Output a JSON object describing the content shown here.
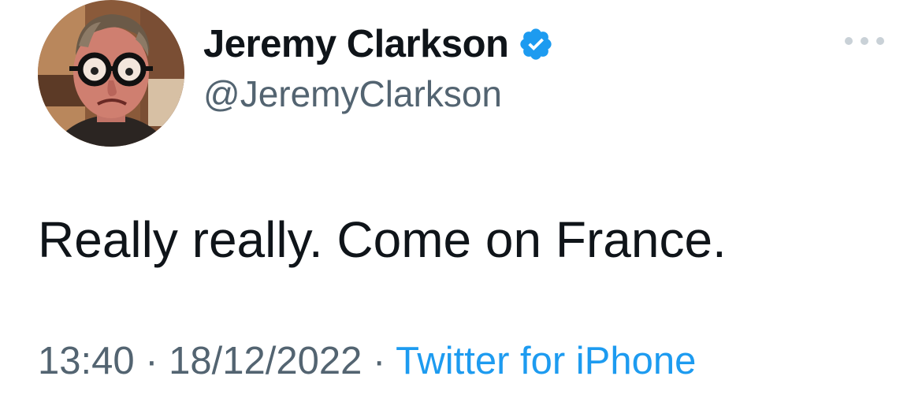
{
  "author": {
    "display_name": "Jeremy Clarkson",
    "handle": "@JeremyClarkson",
    "verified": true,
    "avatar_icon": "profile-photo"
  },
  "tweet": {
    "text": "Really really. Come on France."
  },
  "meta": {
    "time": "13:40",
    "separator_1": " · ",
    "date": "18/12/2022",
    "separator_2": " · ",
    "source": "Twitter for iPhone"
  },
  "colors": {
    "verified_blue": "#1d9bf0",
    "text_primary": "#0f1419",
    "text_secondary": "#536471"
  }
}
